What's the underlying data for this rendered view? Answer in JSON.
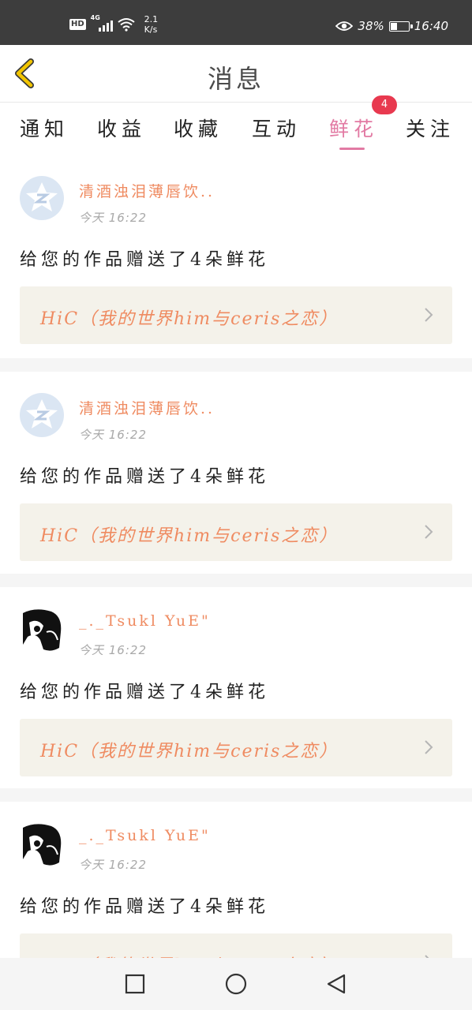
{
  "status_bar": {
    "hd": "HD",
    "network": "4G",
    "net_speed_value": "2.1",
    "net_speed_unit": "K/s",
    "battery_percent": "38%",
    "battery_level": 0.38,
    "time": "16:40",
    "icons": [
      "eye-icon",
      "wifi-icon",
      "signal-icon",
      "battery-icon"
    ]
  },
  "header": {
    "title": "消息",
    "back_icon": "chevron-left-icon"
  },
  "tabs": [
    {
      "label": "通知",
      "active": false
    },
    {
      "label": "收益",
      "active": false
    },
    {
      "label": "收藏",
      "active": false
    },
    {
      "label": "互动",
      "active": false
    },
    {
      "label": "鲜花",
      "active": true,
      "badge": "4"
    },
    {
      "label": "关注",
      "active": false
    }
  ],
  "messages": [
    {
      "avatar": "qq-default-avatar",
      "username": "清酒浊泪薄唇饮..",
      "time": "今天  16:22",
      "text": "给您的作品赠送了4朵鲜花",
      "work_title": "HiC（我的世界him与ceris之恋）"
    },
    {
      "avatar": "qq-default-avatar",
      "username": "清酒浊泪薄唇饮..",
      "time": "今天  16:22",
      "text": "给您的作品赠送了4朵鲜花",
      "work_title": "HiC（我的世界him与ceris之恋）"
    },
    {
      "avatar": "anime-photo-avatar",
      "username": "_._Tsukl YuE\"",
      "time": "今天  16:22",
      "text": "给您的作品赠送了4朵鲜花",
      "work_title": "HiC（我的世界him与ceris之恋）"
    },
    {
      "avatar": "anime-photo-avatar",
      "username": "_._Tsukl YuE\"",
      "time": "今天  16:22",
      "text": "给您的作品赠送了4朵鲜花",
      "work_title": "HiC（我的世界him与ceris之恋）"
    }
  ],
  "colors": {
    "accent_pink": "#e27aa3",
    "username_orange": "#ef8b61",
    "badge_red": "#e8394f",
    "work_box_bg": "#f4f2ea",
    "back_arrow": "#f2c500"
  },
  "nav_bar": {
    "buttons": [
      "recent-apps-square-icon",
      "home-circle-icon",
      "back-triangle-icon"
    ]
  }
}
